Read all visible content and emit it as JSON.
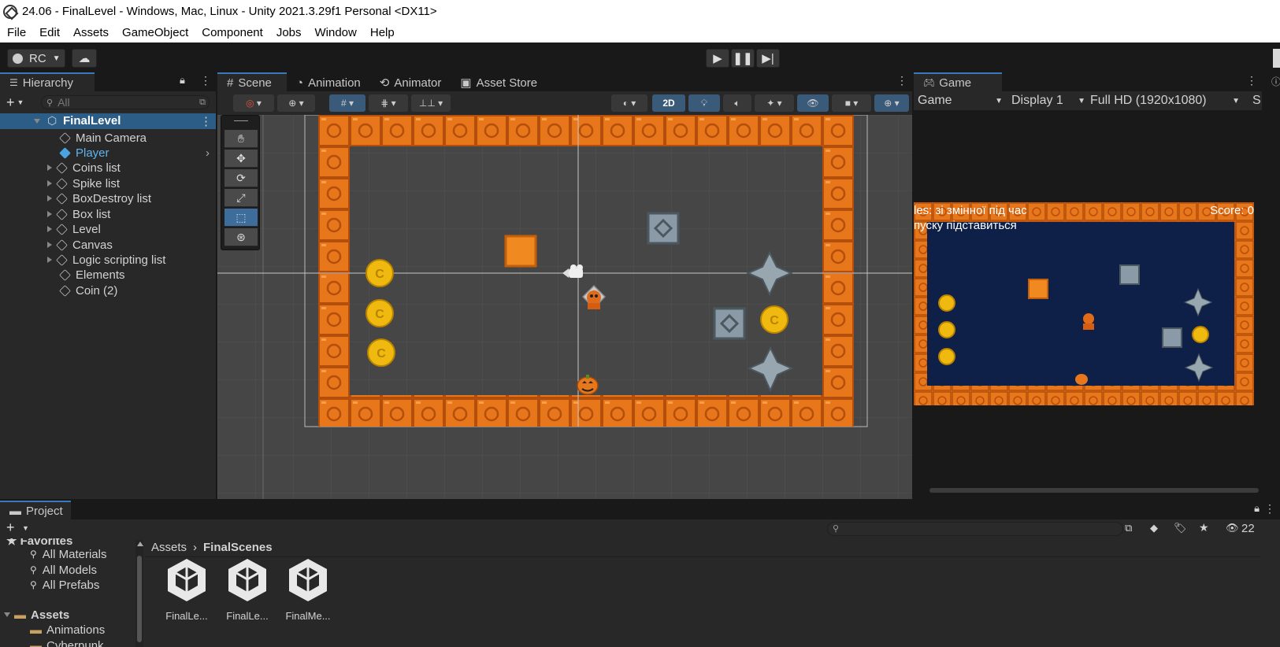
{
  "window": {
    "title": "24.06 - FinalLevel - Windows, Mac, Linux - Unity 2021.3.29f1 Personal <DX11>"
  },
  "menu": [
    "File",
    "Edit",
    "Assets",
    "GameObject",
    "Component",
    "Jobs",
    "Window",
    "Help"
  ],
  "toolbar": {
    "account": "RC"
  },
  "hierarchy": {
    "tab": "Hierarchy",
    "search_placeholder": "All",
    "scene": "FinalLevel",
    "items": [
      {
        "label": "Main Camera",
        "expandable": false
      },
      {
        "label": "Player",
        "expandable": false
      },
      {
        "label": "Coins list",
        "expandable": true
      },
      {
        "label": "Spike list",
        "expandable": true
      },
      {
        "label": "BoxDestroy list",
        "expandable": true
      },
      {
        "label": "Box list",
        "expandable": true
      },
      {
        "label": "Level",
        "expandable": true
      },
      {
        "label": "Canvas",
        "expandable": true
      },
      {
        "label": "Logic scripting list",
        "expandable": true
      },
      {
        "label": "Elements",
        "expandable": false
      },
      {
        "label": "Coin (2)",
        "expandable": false
      }
    ]
  },
  "scene_tabs": [
    "Scene",
    "Animation",
    "Animator",
    "Asset Store"
  ],
  "scene_toolbar": {
    "mode_2d": "2D"
  },
  "game": {
    "tab": "Game",
    "dropdown_game": "Game",
    "display": "Display 1",
    "resolution": "Full HD (1920x1080)",
    "scale_cut": "S",
    "hud_left_1": "les: зі змінної під час",
    "hud_left_2": "пуску підставиться",
    "hud_score": "Score: 0"
  },
  "project": {
    "tab": "Project",
    "favorites_cut": "Favorites",
    "favorites": [
      "All Materials",
      "All Models",
      "All Prefabs"
    ],
    "assets_root": "Assets",
    "asset_folders": [
      "Animations",
      "Cyberpunk"
    ],
    "breadcrumb": [
      "Assets",
      "FinalScenes"
    ],
    "hidden_count": "22",
    "files": [
      "FinalLe...",
      "FinalLe...",
      "FinalMe..."
    ]
  },
  "colors": {
    "accent": "#3a79bb",
    "brick": "#e8761b",
    "coin": "#f0b90f",
    "game_bg": "#0e2047"
  }
}
